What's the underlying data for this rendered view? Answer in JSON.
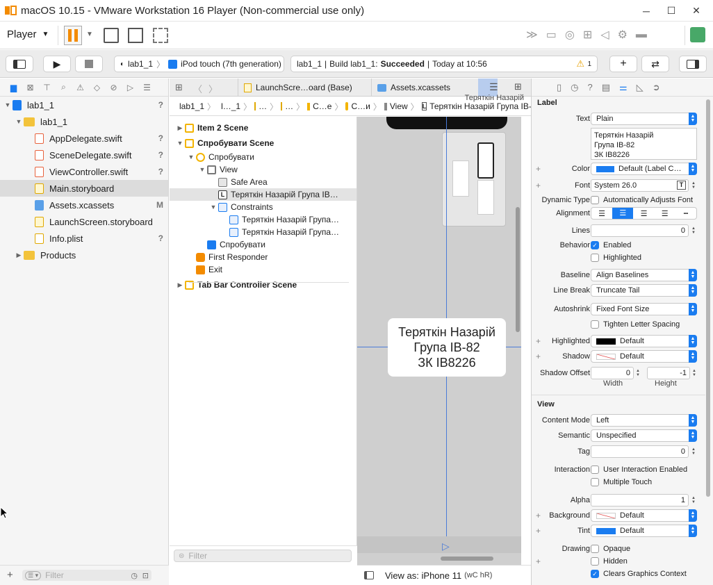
{
  "vm": {
    "title": "macOS 10.15 - VMware Workstation 16 Player (Non-commercial use only)",
    "player_label": "Player",
    "controls": {
      "minimize": "─",
      "maximize": "☐",
      "close": "✕"
    }
  },
  "xcode_toolbar": {
    "scheme": "lab1_1",
    "device": "iPod touch (7th generation)",
    "status_project": "lab1_1",
    "status_build": "Build lab1_1:",
    "status_result": "Succeeded",
    "status_time": "Today at 10:56",
    "warnings": "1"
  },
  "navigator": {
    "items": [
      {
        "label": "lab1_1",
        "status": "?",
        "kind": "project"
      },
      {
        "label": "lab1_1",
        "status": "",
        "kind": "folder"
      },
      {
        "label": "AppDelegate.swift",
        "status": "?",
        "kind": "swift"
      },
      {
        "label": "SceneDelegate.swift",
        "status": "?",
        "kind": "swift"
      },
      {
        "label": "ViewController.swift",
        "status": "?",
        "kind": "swift"
      },
      {
        "label": "Main.storyboard",
        "status": "",
        "kind": "storyboard"
      },
      {
        "label": "Assets.xcassets",
        "status": "M",
        "kind": "assets"
      },
      {
        "label": "LaunchScreen.storyboard",
        "status": "",
        "kind": "storyboard"
      },
      {
        "label": "Info.plist",
        "status": "?",
        "kind": "plist"
      },
      {
        "label": "Products",
        "status": "",
        "kind": "folder"
      }
    ],
    "filter_placeholder": "Filter"
  },
  "tabs": [
    {
      "label": "LaunchScre…oard (Base)"
    },
    {
      "label": "Assets.xcassets"
    }
  ],
  "jumpbar": {
    "items": [
      "lab1_1",
      "l…_1",
      "…",
      "…",
      "C…e",
      "C…и",
      "View",
      "Теряткін Назарій Група ІВ-82"
    ],
    "overflow": "Теряткін Назарій"
  },
  "outline": {
    "rows": [
      {
        "label": "Item 2 Scene",
        "indent": 0,
        "bold": true,
        "tri": "▶",
        "icon": "scene"
      },
      {
        "label": "Спробувати Scene",
        "indent": 0,
        "bold": true,
        "tri": "▼",
        "icon": "scene"
      },
      {
        "label": "Спробувати",
        "indent": 1,
        "bold": false,
        "tri": "▼",
        "icon": "controller"
      },
      {
        "label": "View",
        "indent": 2,
        "bold": false,
        "tri": "▼",
        "icon": "view"
      },
      {
        "label": "Safe Area",
        "indent": 3,
        "bold": false,
        "tri": "",
        "icon": "safearea"
      },
      {
        "label": "Теряткін Назарій  Група ІВ…",
        "indent": 3,
        "bold": false,
        "tri": "",
        "icon": "label",
        "selected": true
      },
      {
        "label": "Constraints",
        "indent": 3,
        "bold": false,
        "tri": "▼",
        "icon": "constraint"
      },
      {
        "label": "Теряткін Назарій  Група…",
        "indent": 4,
        "bold": false,
        "tri": "",
        "icon": "constraint"
      },
      {
        "label": "Теряткін Назарій  Група…",
        "indent": 4,
        "bold": false,
        "tri": "",
        "icon": "constraint"
      },
      {
        "label": "Спробувати",
        "indent": 2,
        "bold": false,
        "tri": "",
        "icon": "tabitem"
      },
      {
        "label": "First Responder",
        "indent": 1,
        "bold": false,
        "tri": "",
        "icon": "responder"
      },
      {
        "label": "Exit",
        "indent": 1,
        "bold": false,
        "tri": "",
        "icon": "exit"
      },
      {
        "label": "Tab Bar Controller Scene",
        "indent": 0,
        "bold": true,
        "tri": "▶",
        "icon": "scene"
      }
    ],
    "filter_placeholder": "Filter"
  },
  "canvas": {
    "label_lines": [
      "Теряткін Назарій",
      "Група ІВ-82",
      "ЗК ІВ8226"
    ],
    "view_as": "View as: iPhone 11",
    "size_class": "(wC hR)"
  },
  "inspector": {
    "label_section": "Label",
    "text_label": "Text",
    "text_value": "Plain",
    "text_content": [
      "Теряткін Назарій",
      "Група ІВ-82",
      "ЗК ІВ8226"
    ],
    "color_label": "Color",
    "color_value": "Default (Label C…",
    "font_label": "Font",
    "font_value": "System 26.0",
    "dynamic_type_label": "Dynamic Type",
    "dynamic_type_value": "Automatically Adjusts Font",
    "alignment_label": "Alignment",
    "lines_label": "Lines",
    "lines_value": "0",
    "behavior_label": "Behavior",
    "behavior_enabled": "Enabled",
    "behavior_highlighted": "Highlighted",
    "baseline_label": "Baseline",
    "baseline_value": "Align Baselines",
    "line_break_label": "Line Break",
    "line_break_value": "Truncate Tail",
    "autoshrink_label": "Autoshrink",
    "autoshrink_value": "Fixed Font Size",
    "tighten_label": "Tighten Letter Spacing",
    "highlighted_label": "Highlighted",
    "highlighted_value": "Default",
    "shadow_label": "Shadow",
    "shadow_value": "Default",
    "shadow_offset_label": "Shadow Offset",
    "shadow_offset_w": "0",
    "shadow_offset_h": "-1",
    "width_caption": "Width",
    "height_caption": "Height",
    "view_section": "View",
    "content_mode_label": "Content Mode",
    "content_mode_value": "Left",
    "semantic_label": "Semantic",
    "semantic_value": "Unspecified",
    "tag_label": "Tag",
    "tag_value": "0",
    "interaction_label": "Interaction",
    "interaction_user": "User Interaction Enabled",
    "interaction_multi": "Multiple Touch",
    "alpha_label": "Alpha",
    "alpha_value": "1",
    "background_label": "Background",
    "background_value": "Default",
    "tint_label": "Tint",
    "tint_value": "Default",
    "drawing_label": "Drawing",
    "drawing_opaque": "Opaque",
    "drawing_hidden": "Hidden",
    "drawing_clears": "Clears Graphics Context"
  },
  "colors": {
    "accent": "#1a7cf0",
    "folder": "#f3c33b",
    "vmware_orange": "#f38b00"
  }
}
